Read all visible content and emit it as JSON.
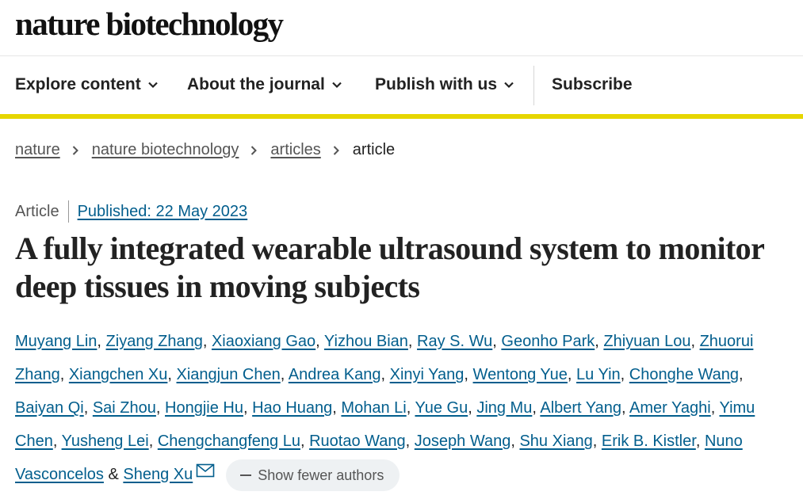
{
  "header": {
    "logo_text": "nature biotechnology"
  },
  "nav": {
    "items": [
      {
        "label": "Explore content",
        "icon": "chevron-down-icon"
      },
      {
        "label": "About the journal",
        "icon": "chevron-down-icon"
      },
      {
        "label": "Publish with us",
        "icon": "chevron-down-icon"
      },
      {
        "label": "Subscribe"
      }
    ],
    "accent_color": "#e6d600"
  },
  "breadcrumb": {
    "items": [
      "nature",
      "nature biotechnology",
      "articles"
    ],
    "current": "article"
  },
  "article": {
    "type": "Article",
    "published": "Published: 22 May 2023",
    "title": "A fully integrated wearable ultrasound system to monitor deep tissues in moving subjects",
    "authors": [
      "Muyang Lin",
      "Ziyang Zhang",
      "Xiaoxiang Gao",
      "Yizhou Bian",
      "Ray S. Wu",
      "Geonho Park",
      "Zhiyuan Lou",
      "Zhuorui Zhang",
      "Xiangchen Xu",
      "Xiangjun Chen",
      "Andrea Kang",
      "Xinyi Yang",
      "Wentong Yue",
      "Lu Yin",
      "Chonghe Wang",
      "Baiyan Qi",
      "Sai Zhou",
      "Hongjie Hu",
      "Hao Huang",
      "Mohan Li",
      "Yue Gu",
      "Jing Mu",
      "Albert Yang",
      "Amer Yaghi",
      "Yimu Chen",
      "Yusheng Lei",
      "Chengchangfeng Lu",
      "Ruotao Wang",
      "Joseph Wang",
      "Shu Xiang",
      "Erik B. Kistler",
      "Nuno Vasconcelos",
      "Sheng Xu"
    ],
    "author_separator": ", ",
    "last_separator": " & ",
    "corresponding_icon": "mail-icon",
    "show_fewer_label": "Show fewer authors",
    "link_color": "#025e8d"
  }
}
